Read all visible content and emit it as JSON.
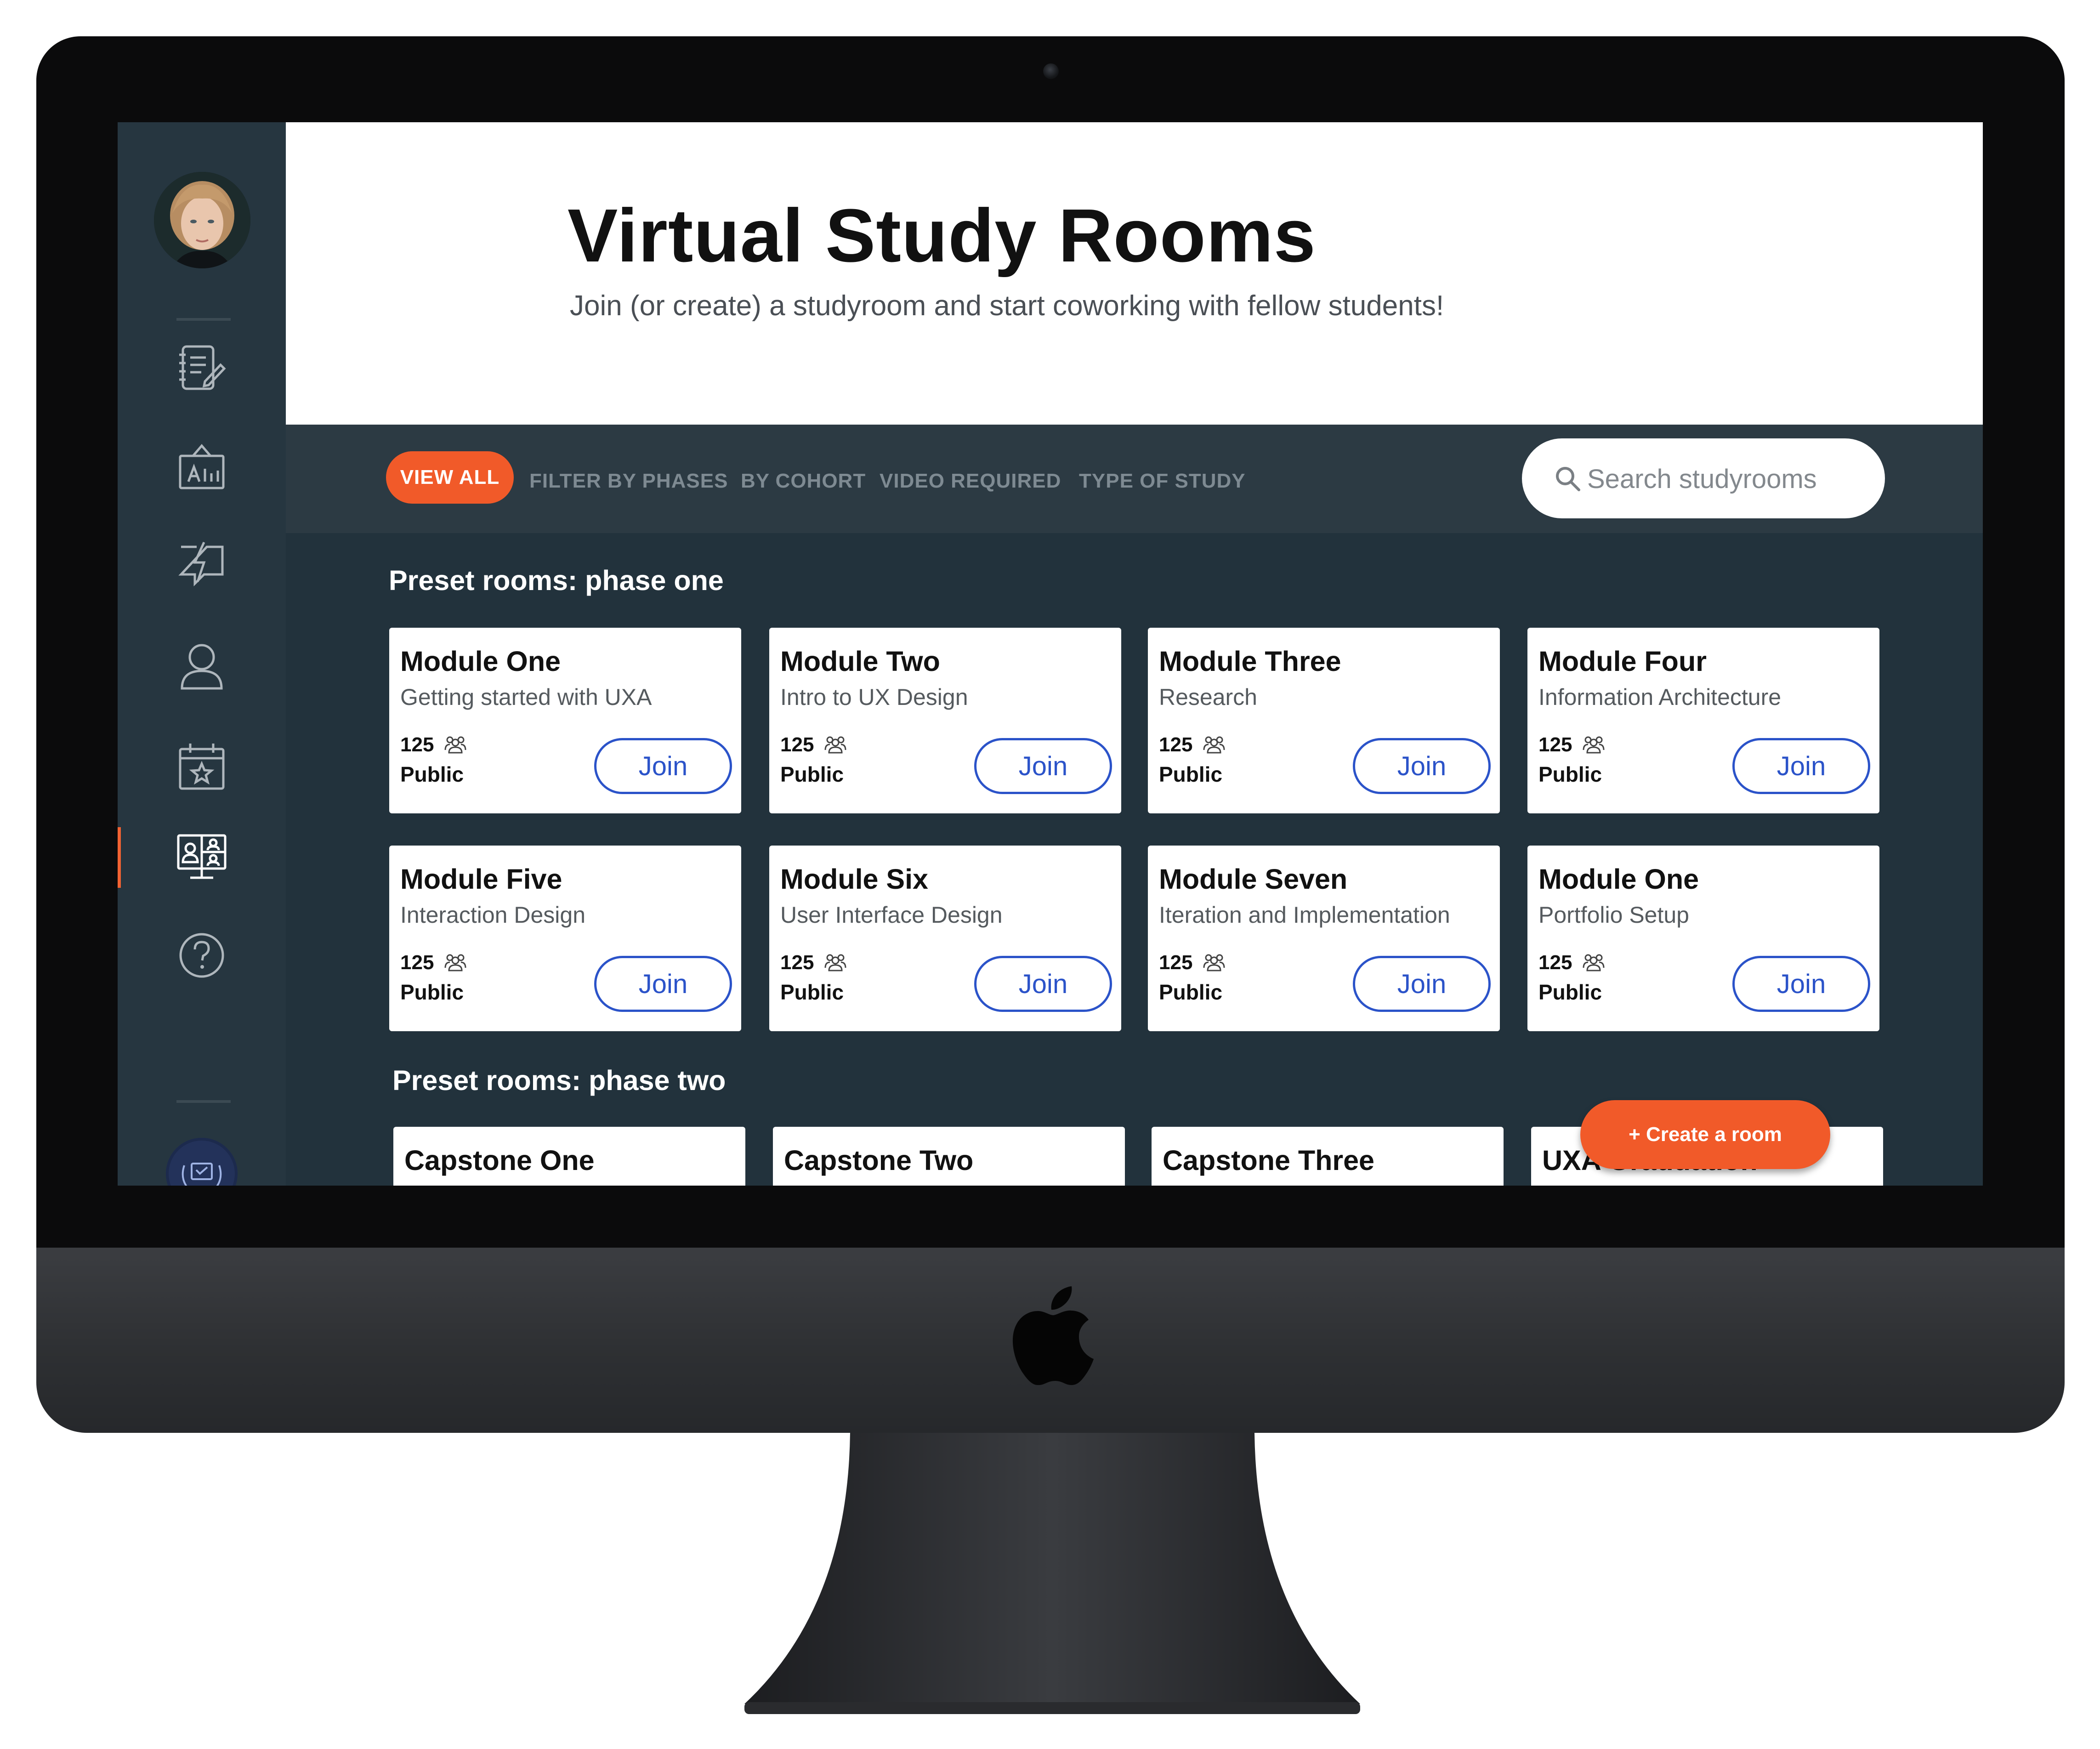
{
  "header": {
    "title": "Virtual Study Rooms",
    "subtitle": "Join (or create) a studyroom and start coworking with fellow students!"
  },
  "sidebar": {
    "items": [
      {
        "icon": "notebook-icon"
      },
      {
        "icon": "whiteboard-icon"
      },
      {
        "icon": "lightning-chat-icon"
      },
      {
        "icon": "user-icon"
      },
      {
        "icon": "calendar-star-icon"
      },
      {
        "icon": "study-room-icon",
        "active": true
      },
      {
        "icon": "help-icon"
      }
    ],
    "accent": "#f26232"
  },
  "filters": {
    "view_all": "VIEW ALL",
    "phases": "FILTER BY PHASES",
    "cohort": "BY COHORT",
    "video": "VIDEO REQUIRED",
    "study_type": "TYPE OF STUDY"
  },
  "search": {
    "placeholder": "Search studyrooms"
  },
  "sections": [
    {
      "title": "Preset rooms: phase one",
      "cards": [
        {
          "title": "Module One",
          "subtitle": "Getting started with UXA",
          "count": "125",
          "visibility": "Public",
          "join": "Join"
        },
        {
          "title": "Module Two",
          "subtitle": "Intro to UX Design",
          "count": "125",
          "visibility": "Public",
          "join": "Join"
        },
        {
          "title": "Module Three",
          "subtitle": "Research",
          "count": "125",
          "visibility": "Public",
          "join": "Join"
        },
        {
          "title": "Module Four",
          "subtitle": "Information Architecture",
          "count": "125",
          "visibility": "Public",
          "join": "Join"
        },
        {
          "title": "Module Five",
          "subtitle": "Interaction Design",
          "count": "125",
          "visibility": "Public",
          "join": "Join"
        },
        {
          "title": "Module Six",
          "subtitle": "User Interface Design",
          "count": "125",
          "visibility": "Public",
          "join": "Join"
        },
        {
          "title": "Module Seven",
          "subtitle": "Iteration and Implementation",
          "count": "125",
          "visibility": "Public",
          "join": "Join"
        },
        {
          "title": "Module One",
          "subtitle": "Portfolio Setup",
          "count": "125",
          "visibility": "Public",
          "join": "Join"
        }
      ]
    },
    {
      "title": "Preset rooms: phase two",
      "cards": [
        {
          "title": "Capstone One"
        },
        {
          "title": "Capstone Two"
        },
        {
          "title": "Capstone Three"
        },
        {
          "title": "UXA Graduation"
        }
      ]
    }
  ],
  "create_button": "+ Create a room",
  "colors": {
    "accent": "#f15a29",
    "join_blue": "#2b53c9",
    "background": "#22323c",
    "filterbar": "#2c3a43"
  }
}
